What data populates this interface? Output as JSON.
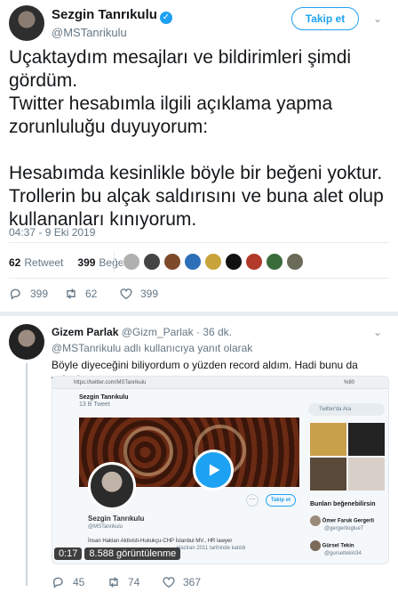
{
  "tweet": {
    "author_name": "Sezgin Tanrıkulu",
    "author_handle": "@MSTanrikulu",
    "follow_label": "Takip et",
    "body": "Uçaktaydım mesajları ve bildirimleri şimdi\ngördüm.\nTwitter hesabımla ilgili açıklama yapma\nzorunluluğu duyuyorum:\n\nHesabımda kesinlikle böyle bir beğeni yoktur.\nTrollerin bu alçak saldırısını ve buna alet olup\nkullananları kınıyorum.",
    "timestamp": "04:37 - 9 Eki 2019",
    "retweet_count": "62",
    "retweet_label": "Retweet",
    "like_count": "399",
    "like_label": "Beğeni",
    "actions": {
      "reply": "399",
      "retweet": "62",
      "like": "399"
    }
  },
  "reply": {
    "author_name": "Gizem Parlak",
    "author_handle": "@Gizm_Parlak",
    "time": "· 36 dk.",
    "reply_to": "@MSTanrikulu adlı kullanıcıya yanıt olarak",
    "body": "Böyle diyeceğini biliyordum o yüzden record aldım. Hadi bunu da yalanla.",
    "video_time": "0:17",
    "video_views": "8.588 görüntülenme",
    "actions": {
      "reply": "45",
      "retweet": "74",
      "like": "367"
    }
  },
  "video_frame": {
    "url": "https://twitter.com/MSTanrikulu",
    "zoom": "%80",
    "profile_name": "Sezgin Tanrıkulu",
    "profile_sub": "13 B Tweet",
    "profile_handle": "@MSTanrikulu",
    "bio": "İnsan Hakları Aktivisti-Hukukçu-CHP İstanbul MV., HR lawyer",
    "joined": "Haziran 2011 tarihinde katıldı",
    "follow_label": "Takip et",
    "search_placeholder": "Twitter'da Ara",
    "side_heading": "Bunları beğenebilirsin",
    "suggest_1": "Ömer Faruk Gergerli",
    "suggest_1_handle": "@gergerlioglueT",
    "suggest_2": "Gürsel Tekin",
    "suggest_2_handle": "@gurseltekin34"
  },
  "colors": {
    "accent": "#1da1f2",
    "muted": "#657786"
  }
}
